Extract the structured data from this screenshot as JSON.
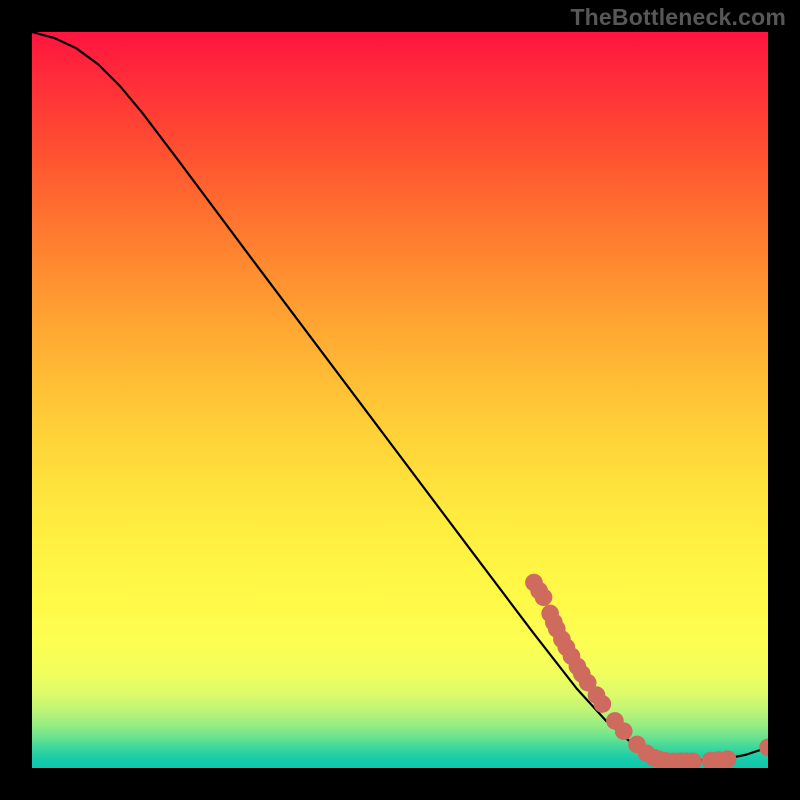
{
  "watermark": "TheBottleneck.com",
  "chart_data": {
    "type": "line",
    "title": "",
    "xlabel": "",
    "ylabel": "",
    "xlim": [
      0,
      100
    ],
    "ylim": [
      0,
      100
    ],
    "grid": false,
    "legend": false,
    "note": "Axes are unlabeled; values below are normalized 0–100 read from pixel positions. The solid curve starts near the top-left, drops with a slight initial bend, descends nearly linearly, then flattens near the bottom-right. Markers (dots) appear only along the lower-right portion of the curve.",
    "series": [
      {
        "name": "curve",
        "style": "line",
        "color": "#000000",
        "points": [
          {
            "x": 0.0,
            "y": 100.0
          },
          {
            "x": 3.0,
            "y": 99.2
          },
          {
            "x": 6.0,
            "y": 97.8
          },
          {
            "x": 9.0,
            "y": 95.6
          },
          {
            "x": 12.0,
            "y": 92.6
          },
          {
            "x": 15.0,
            "y": 89.0
          },
          {
            "x": 20.0,
            "y": 82.4
          },
          {
            "x": 30.0,
            "y": 69.0
          },
          {
            "x": 40.0,
            "y": 55.7
          },
          {
            "x": 50.0,
            "y": 42.4
          },
          {
            "x": 60.0,
            "y": 29.1
          },
          {
            "x": 68.0,
            "y": 18.5
          },
          {
            "x": 74.0,
            "y": 10.8
          },
          {
            "x": 78.0,
            "y": 6.4
          },
          {
            "x": 81.0,
            "y": 3.8
          },
          {
            "x": 84.0,
            "y": 2.0
          },
          {
            "x": 87.0,
            "y": 1.2
          },
          {
            "x": 90.0,
            "y": 1.0
          },
          {
            "x": 94.0,
            "y": 1.2
          },
          {
            "x": 97.0,
            "y": 1.8
          },
          {
            "x": 100.0,
            "y": 2.8
          }
        ]
      },
      {
        "name": "markers",
        "style": "scatter",
        "color": "#cf6a5e",
        "radius": 1.2,
        "points": [
          {
            "x": 68.2,
            "y": 25.2
          },
          {
            "x": 68.9,
            "y": 24.1
          },
          {
            "x": 69.5,
            "y": 23.2
          },
          {
            "x": 70.4,
            "y": 21.0
          },
          {
            "x": 70.9,
            "y": 19.8
          },
          {
            "x": 71.3,
            "y": 18.9
          },
          {
            "x": 72.0,
            "y": 17.5
          },
          {
            "x": 72.6,
            "y": 16.4
          },
          {
            "x": 73.3,
            "y": 15.2
          },
          {
            "x": 74.1,
            "y": 13.8
          },
          {
            "x": 74.7,
            "y": 12.8
          },
          {
            "x": 75.5,
            "y": 11.6
          },
          {
            "x": 76.7,
            "y": 9.9
          },
          {
            "x": 77.5,
            "y": 8.7
          },
          {
            "x": 79.2,
            "y": 6.4
          },
          {
            "x": 80.4,
            "y": 5.0
          },
          {
            "x": 82.2,
            "y": 3.2
          },
          {
            "x": 83.5,
            "y": 2.0
          },
          {
            "x": 84.5,
            "y": 1.4
          },
          {
            "x": 85.1,
            "y": 1.2
          },
          {
            "x": 86.0,
            "y": 1.0
          },
          {
            "x": 87.2,
            "y": 0.9
          },
          {
            "x": 88.1,
            "y": 0.9
          },
          {
            "x": 88.9,
            "y": 0.9
          },
          {
            "x": 89.8,
            "y": 0.9
          },
          {
            "x": 92.2,
            "y": 1.0
          },
          {
            "x": 93.3,
            "y": 1.1
          },
          {
            "x": 94.5,
            "y": 1.2
          },
          {
            "x": 100.0,
            "y": 2.8
          }
        ]
      }
    ]
  }
}
